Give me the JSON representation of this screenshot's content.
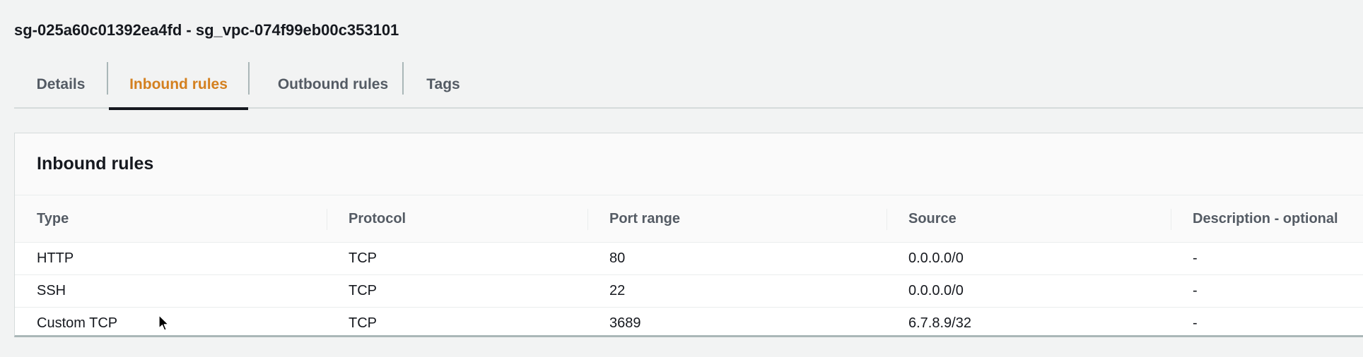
{
  "security_group": {
    "title": "sg-025a60c01392ea4fd - sg_vpc-074f99eb00c353101"
  },
  "tabs": [
    {
      "label": "Details",
      "active": false
    },
    {
      "label": "Inbound rules",
      "active": true
    },
    {
      "label": "Outbound rules",
      "active": false
    },
    {
      "label": "Tags",
      "active": false
    }
  ],
  "inbound_panel": {
    "title": "Inbound rules",
    "columns": [
      "Type",
      "Protocol",
      "Port range",
      "Source",
      "Description - optional"
    ],
    "rows": [
      {
        "type": "HTTP",
        "protocol": "TCP",
        "port_range": "80",
        "source": "0.0.0.0/0",
        "description": "-"
      },
      {
        "type": "SSH",
        "protocol": "TCP",
        "port_range": "22",
        "source": "0.0.0.0/0",
        "description": "-"
      },
      {
        "type": "Custom TCP",
        "protocol": "TCP",
        "port_range": "3689",
        "source": "6.7.8.9/32",
        "description": "-"
      }
    ]
  },
  "colors": {
    "active_tab": "#d4801f",
    "background": "#f2f3f3",
    "text": "#16191f"
  },
  "icons": {
    "cursor": "mouse-pointer-icon"
  }
}
